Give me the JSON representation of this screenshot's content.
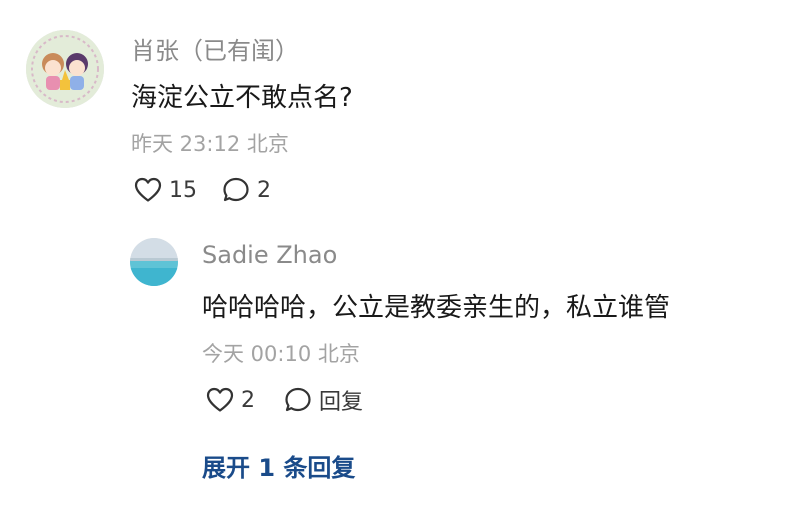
{
  "comment": {
    "author": "肖张（已有闺）",
    "text": "海淀公立不敢点名?",
    "meta": "昨天 23:12 北京",
    "likes": "15",
    "replies": "2",
    "avatar_icon": "anime-girls-avatar"
  },
  "reply": {
    "author": "Sadie Zhao",
    "text": "哈哈哈哈，公立是教委亲生的，私立谁管",
    "meta": "今天 00:10 北京",
    "likes": "2",
    "reply_label": "回复",
    "avatar_icon": "ocean-scenery-avatar"
  },
  "expand_label": "展开 1 条回复",
  "colors": {
    "name": "#8a8a8a",
    "text": "#191919",
    "meta": "#a3a3a3",
    "link": "#1a4b8a"
  }
}
